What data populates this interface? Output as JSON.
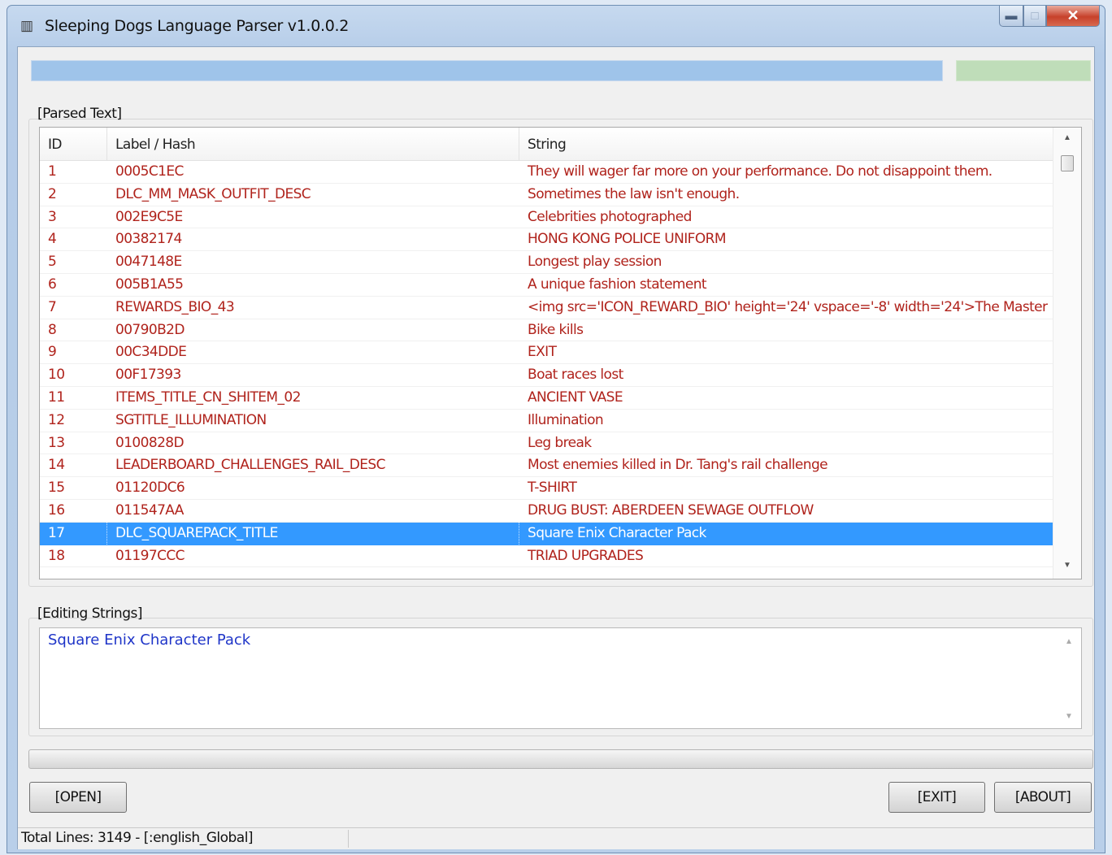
{
  "window": {
    "title": "Sleeping Dogs Language Parser v1.0.0.2",
    "icon": "app-icon",
    "controls": {
      "minimize": "minimize-icon",
      "maximize": "maximize-icon",
      "close": "close-icon"
    }
  },
  "colors": {
    "progress": "#9fc4ea",
    "status_ok": "#bfddb9",
    "selection": "#3399ff",
    "row_text": "#b0231c",
    "edit_text": "#1f35c8"
  },
  "parsed": {
    "group_label": "[Parsed Text]",
    "columns": [
      "ID",
      "Label / Hash",
      "String"
    ],
    "selected_id": "17",
    "rows": [
      {
        "id": "1",
        "label": "0005C1EC",
        "string": "They will wager far more on your performance. Do not disappoint them."
      },
      {
        "id": "2",
        "label": "DLC_MM_MASK_OUTFIT_DESC",
        "string": "Sometimes the law isn't enough."
      },
      {
        "id": "3",
        "label": "002E9C5E",
        "string": "Celebrities photographed"
      },
      {
        "id": "4",
        "label": "00382174",
        "string": "HONG KONG POLICE UNIFORM"
      },
      {
        "id": "5",
        "label": "0047148E",
        "string": "Longest play session"
      },
      {
        "id": "6",
        "label": "005B1A55",
        "string": "A unique fashion statement"
      },
      {
        "id": "7",
        "label": "REWARDS_BIO_43",
        "string": "<img src='ICON_REWARD_BIO' height='24' vspace='-8' width='24'>The Master"
      },
      {
        "id": "8",
        "label": "00790B2D",
        "string": "Bike kills"
      },
      {
        "id": "9",
        "label": "00C34DDE",
        "string": "EXIT"
      },
      {
        "id": "10",
        "label": "00F17393",
        "string": "Boat races lost"
      },
      {
        "id": "11",
        "label": "ITEMS_TITLE_CN_SHITEM_02",
        "string": "ANCIENT VASE"
      },
      {
        "id": "12",
        "label": "SGTITLE_ILLUMINATION",
        "string": "Illumination"
      },
      {
        "id": "13",
        "label": "0100828D",
        "string": "Leg break"
      },
      {
        "id": "14",
        "label": "LEADERBOARD_CHALLENGES_RAIL_DESC",
        "string": "Most enemies killed in Dr. Tang's rail challenge"
      },
      {
        "id": "15",
        "label": "01120DC6",
        "string": "T-SHIRT"
      },
      {
        "id": "16",
        "label": "011547AA",
        "string": "DRUG BUST: ABERDEEN SEWAGE OUTFLOW"
      },
      {
        "id": "17",
        "label": "DLC_SQUAREPACK_TITLE",
        "string": "Square Enix Character Pack"
      },
      {
        "id": "18",
        "label": "01197CCC",
        "string": "TRIAD UPGRADES"
      }
    ]
  },
  "editing": {
    "group_label": "[Editing Strings]",
    "value": "Square Enix Character Pack"
  },
  "buttons": {
    "open": "[OPEN]",
    "exit": "[EXIT]",
    "about": "[ABOUT]"
  },
  "status": {
    "text": "Total Lines: 3149 - [:english_Global]"
  }
}
